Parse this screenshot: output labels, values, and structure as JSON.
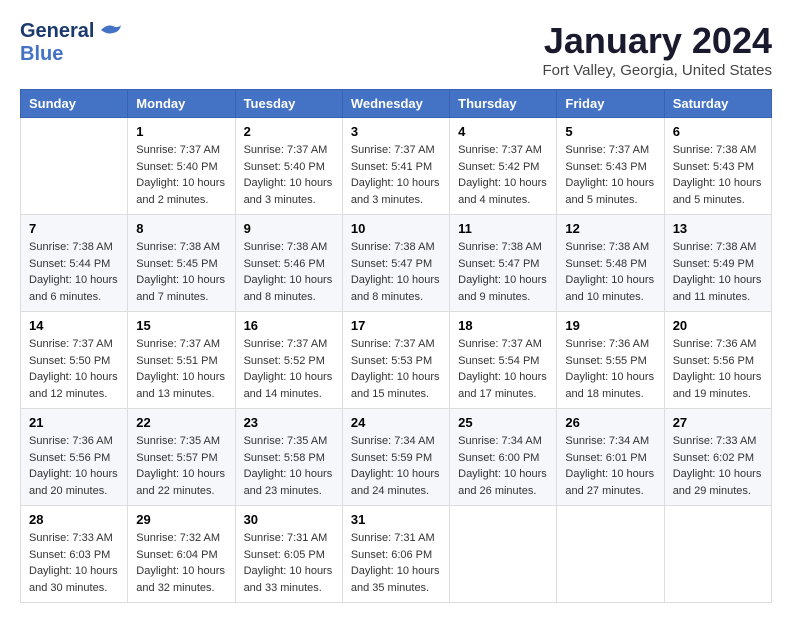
{
  "app": {
    "logo_line1": "General",
    "logo_line2": "Blue",
    "calendar_title": "January 2024",
    "subtitle": "Fort Valley, Georgia, United States"
  },
  "calendar": {
    "headers": [
      "Sunday",
      "Monday",
      "Tuesday",
      "Wednesday",
      "Thursday",
      "Friday",
      "Saturday"
    ],
    "weeks": [
      [
        {
          "day": "",
          "info": ""
        },
        {
          "day": "1",
          "info": "Sunrise: 7:37 AM\nSunset: 5:40 PM\nDaylight: 10 hours\nand 2 minutes."
        },
        {
          "day": "2",
          "info": "Sunrise: 7:37 AM\nSunset: 5:40 PM\nDaylight: 10 hours\nand 3 minutes."
        },
        {
          "day": "3",
          "info": "Sunrise: 7:37 AM\nSunset: 5:41 PM\nDaylight: 10 hours\nand 3 minutes."
        },
        {
          "day": "4",
          "info": "Sunrise: 7:37 AM\nSunset: 5:42 PM\nDaylight: 10 hours\nand 4 minutes."
        },
        {
          "day": "5",
          "info": "Sunrise: 7:37 AM\nSunset: 5:43 PM\nDaylight: 10 hours\nand 5 minutes."
        },
        {
          "day": "6",
          "info": "Sunrise: 7:38 AM\nSunset: 5:43 PM\nDaylight: 10 hours\nand 5 minutes."
        }
      ],
      [
        {
          "day": "7",
          "info": "Sunrise: 7:38 AM\nSunset: 5:44 PM\nDaylight: 10 hours\nand 6 minutes."
        },
        {
          "day": "8",
          "info": "Sunrise: 7:38 AM\nSunset: 5:45 PM\nDaylight: 10 hours\nand 7 minutes."
        },
        {
          "day": "9",
          "info": "Sunrise: 7:38 AM\nSunset: 5:46 PM\nDaylight: 10 hours\nand 8 minutes."
        },
        {
          "day": "10",
          "info": "Sunrise: 7:38 AM\nSunset: 5:47 PM\nDaylight: 10 hours\nand 8 minutes."
        },
        {
          "day": "11",
          "info": "Sunrise: 7:38 AM\nSunset: 5:47 PM\nDaylight: 10 hours\nand 9 minutes."
        },
        {
          "day": "12",
          "info": "Sunrise: 7:38 AM\nSunset: 5:48 PM\nDaylight: 10 hours\nand 10 minutes."
        },
        {
          "day": "13",
          "info": "Sunrise: 7:38 AM\nSunset: 5:49 PM\nDaylight: 10 hours\nand 11 minutes."
        }
      ],
      [
        {
          "day": "14",
          "info": "Sunrise: 7:37 AM\nSunset: 5:50 PM\nDaylight: 10 hours\nand 12 minutes."
        },
        {
          "day": "15",
          "info": "Sunrise: 7:37 AM\nSunset: 5:51 PM\nDaylight: 10 hours\nand 13 minutes."
        },
        {
          "day": "16",
          "info": "Sunrise: 7:37 AM\nSunset: 5:52 PM\nDaylight: 10 hours\nand 14 minutes."
        },
        {
          "day": "17",
          "info": "Sunrise: 7:37 AM\nSunset: 5:53 PM\nDaylight: 10 hours\nand 15 minutes."
        },
        {
          "day": "18",
          "info": "Sunrise: 7:37 AM\nSunset: 5:54 PM\nDaylight: 10 hours\nand 17 minutes."
        },
        {
          "day": "19",
          "info": "Sunrise: 7:36 AM\nSunset: 5:55 PM\nDaylight: 10 hours\nand 18 minutes."
        },
        {
          "day": "20",
          "info": "Sunrise: 7:36 AM\nSunset: 5:56 PM\nDaylight: 10 hours\nand 19 minutes."
        }
      ],
      [
        {
          "day": "21",
          "info": "Sunrise: 7:36 AM\nSunset: 5:56 PM\nDaylight: 10 hours\nand 20 minutes."
        },
        {
          "day": "22",
          "info": "Sunrise: 7:35 AM\nSunset: 5:57 PM\nDaylight: 10 hours\nand 22 minutes."
        },
        {
          "day": "23",
          "info": "Sunrise: 7:35 AM\nSunset: 5:58 PM\nDaylight: 10 hours\nand 23 minutes."
        },
        {
          "day": "24",
          "info": "Sunrise: 7:34 AM\nSunset: 5:59 PM\nDaylight: 10 hours\nand 24 minutes."
        },
        {
          "day": "25",
          "info": "Sunrise: 7:34 AM\nSunset: 6:00 PM\nDaylight: 10 hours\nand 26 minutes."
        },
        {
          "day": "26",
          "info": "Sunrise: 7:34 AM\nSunset: 6:01 PM\nDaylight: 10 hours\nand 27 minutes."
        },
        {
          "day": "27",
          "info": "Sunrise: 7:33 AM\nSunset: 6:02 PM\nDaylight: 10 hours\nand 29 minutes."
        }
      ],
      [
        {
          "day": "28",
          "info": "Sunrise: 7:33 AM\nSunset: 6:03 PM\nDaylight: 10 hours\nand 30 minutes."
        },
        {
          "day": "29",
          "info": "Sunrise: 7:32 AM\nSunset: 6:04 PM\nDaylight: 10 hours\nand 32 minutes."
        },
        {
          "day": "30",
          "info": "Sunrise: 7:31 AM\nSunset: 6:05 PM\nDaylight: 10 hours\nand 33 minutes."
        },
        {
          "day": "31",
          "info": "Sunrise: 7:31 AM\nSunset: 6:06 PM\nDaylight: 10 hours\nand 35 minutes."
        },
        {
          "day": "",
          "info": ""
        },
        {
          "day": "",
          "info": ""
        },
        {
          "day": "",
          "info": ""
        }
      ]
    ]
  }
}
